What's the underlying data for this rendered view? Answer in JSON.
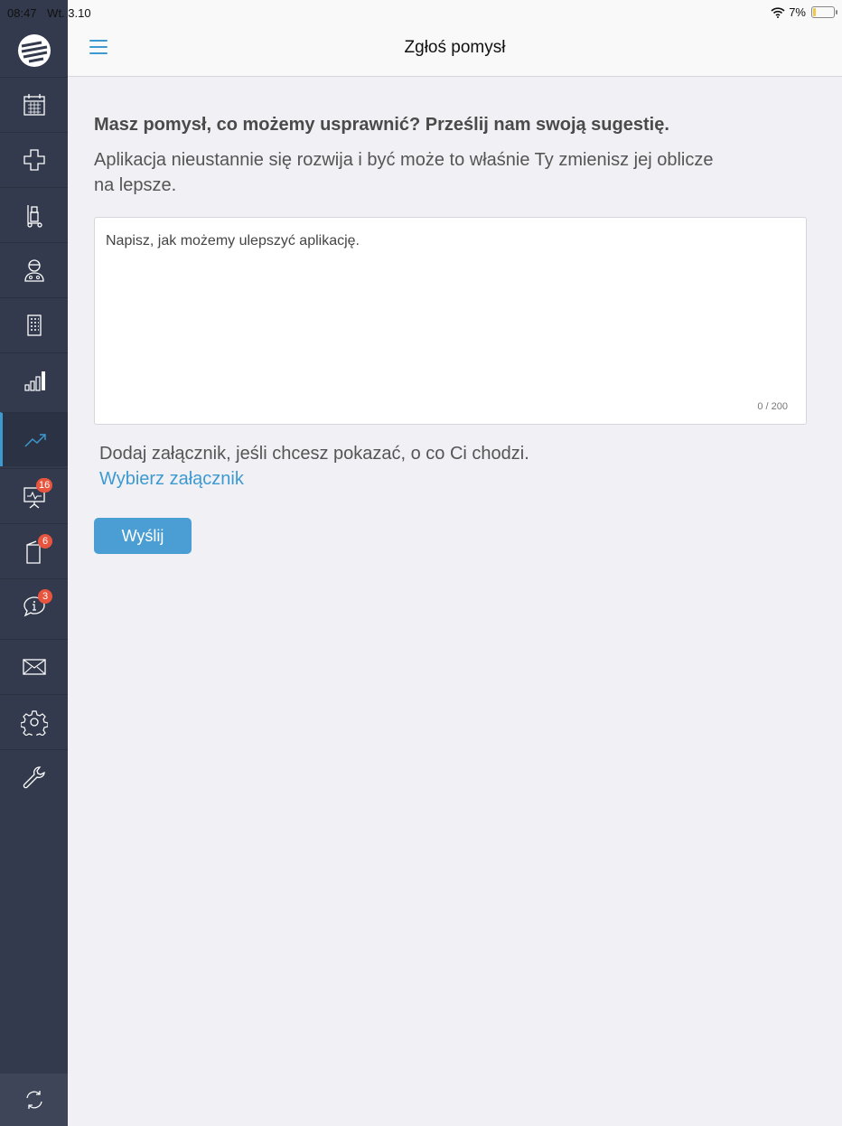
{
  "status_bar": {
    "time": "08:47",
    "date": "Wt. 3.10",
    "battery": "7%"
  },
  "header": {
    "title": "Zgłoś pomysł"
  },
  "sidebar": {
    "items": [
      {
        "icon": "calendar-icon"
      },
      {
        "icon": "medical-cross-icon"
      },
      {
        "icon": "hand-truck-icon"
      },
      {
        "icon": "doctor-icon"
      },
      {
        "icon": "building-icon"
      },
      {
        "icon": "bar-chart-icon"
      },
      {
        "icon": "trend-icon",
        "active": true
      },
      {
        "icon": "presentation-icon",
        "badge": "16"
      },
      {
        "icon": "book-icon",
        "badge": "6"
      },
      {
        "icon": "info-chat-icon",
        "badge": "3"
      },
      {
        "icon": "mail-icon"
      },
      {
        "icon": "gear-icon"
      },
      {
        "icon": "wrench-icon"
      }
    ]
  },
  "main": {
    "heading": "Masz pomysł, co możemy usprawnić? Prześlij nam swoją sugestię.",
    "subtext": "Aplikacja nieustannie się rozwija i być może to właśnie Ty zmienisz jej oblicze na lepsze.",
    "textarea_placeholder": "Napisz, jak możemy ulepszyć aplikację.",
    "counter": "0 / 200",
    "attach_text": "Dodaj załącznik, jeśli chcesz pokazać, o co Ci chodzi.",
    "attach_link": "Wybierz załącznik",
    "send_button": "Wyślij"
  },
  "colors": {
    "accent": "#3d9ad1",
    "sidebar": "#333a4d",
    "badge": "#e8553e"
  }
}
